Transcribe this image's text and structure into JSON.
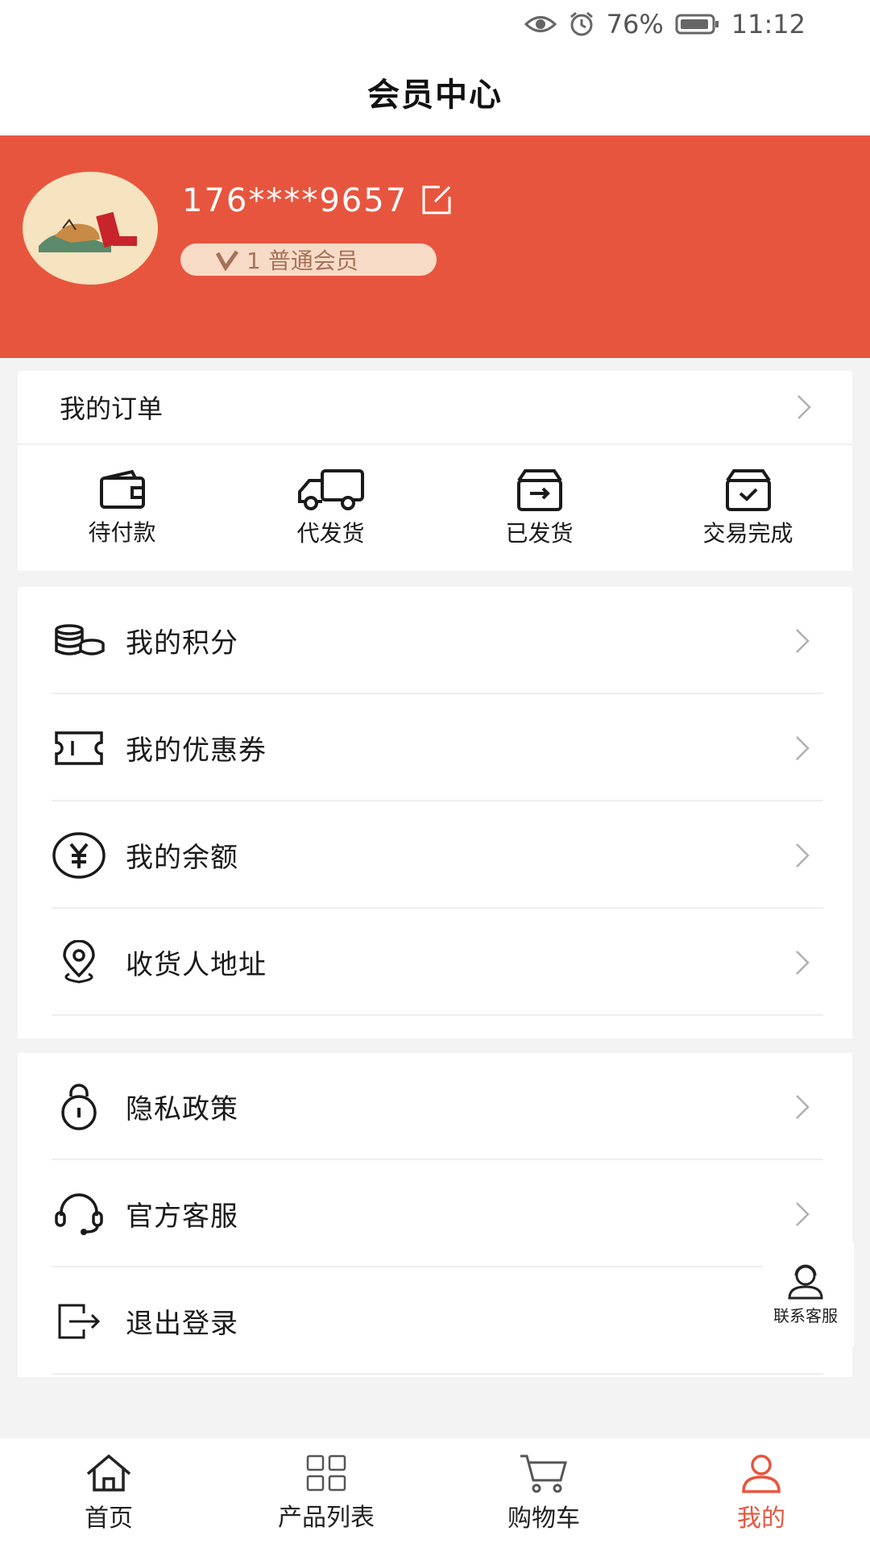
{
  "status_bar": {
    "battery": "76%",
    "time": "11:12"
  },
  "nav": {
    "title": "会员中心"
  },
  "profile": {
    "phone": "176****9657",
    "level_icon_text": "V",
    "level": "1 普通会员"
  },
  "orders": {
    "title": "我的订单",
    "items": [
      {
        "label": "待付款",
        "icon": "wallet-icon"
      },
      {
        "label": "代发货",
        "icon": "truck-icon"
      },
      {
        "label": "已发货",
        "icon": "shipped-box-icon"
      },
      {
        "label": "交易完成",
        "icon": "completed-box-icon"
      }
    ]
  },
  "menu1": [
    {
      "label": "我的积分",
      "icon": "coins-icon"
    },
    {
      "label": "我的优惠券",
      "icon": "ticket-icon"
    },
    {
      "label": "我的余额",
      "icon": "yuan-icon"
    },
    {
      "label": "收货人地址",
      "icon": "location-icon"
    }
  ],
  "menu2": [
    {
      "label": "隐私政策",
      "icon": "lock-icon"
    },
    {
      "label": "官方客服",
      "icon": "headset-icon"
    },
    {
      "label": "退出登录",
      "icon": "logout-icon"
    }
  ],
  "float_service": {
    "label": "联系客服"
  },
  "tabs": [
    {
      "label": "首页",
      "icon": "home-icon"
    },
    {
      "label": "产品列表",
      "icon": "grid-icon"
    },
    {
      "label": "购物车",
      "icon": "cart-icon"
    },
    {
      "label": "我的",
      "icon": "user-icon",
      "active": true
    }
  ],
  "colors": {
    "brand": "#e8553e",
    "badge_bg": "#f8dbc7",
    "badge_text": "#a67259"
  }
}
